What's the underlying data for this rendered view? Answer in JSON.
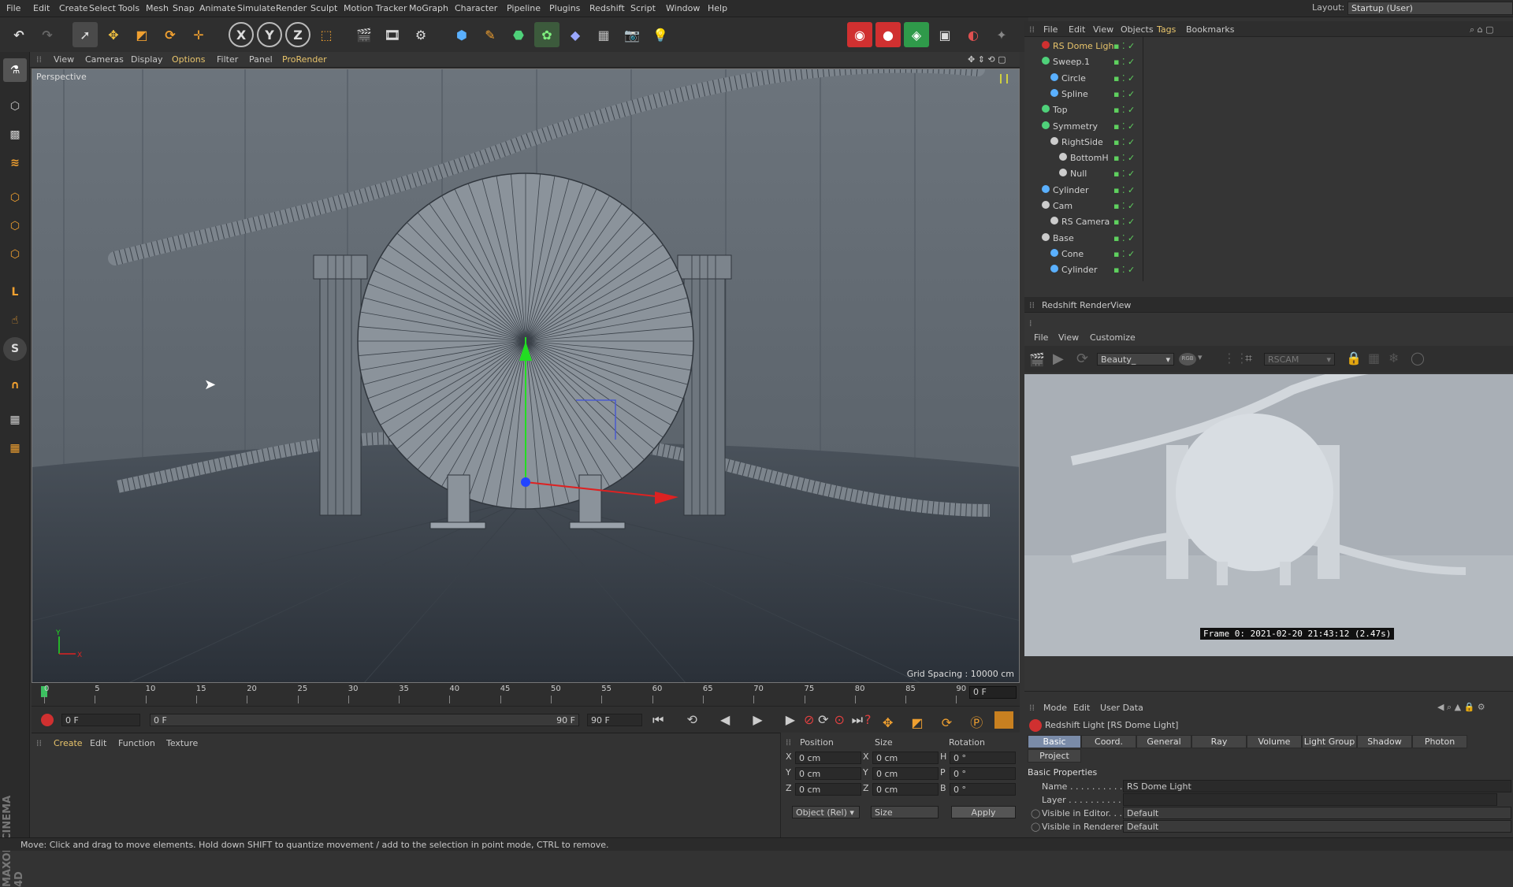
{
  "menu": [
    "File",
    "Edit",
    "Create",
    "Select",
    "Tools",
    "Mesh",
    "Snap",
    "Animate",
    "Simulate",
    "Render",
    "Sculpt",
    "Motion Tracker",
    "MoGraph",
    "Character",
    "Pipeline",
    "Plugins",
    "Redshift",
    "Script",
    "Window",
    "Help"
  ],
  "layout": {
    "label": "Layout:",
    "value": "Startup (User)"
  },
  "viewport": {
    "menu": [
      "View",
      "Cameras",
      "Display",
      "Options",
      "Filter",
      "Panel",
      "ProRender"
    ],
    "label": "Perspective",
    "grid_spacing": "Grid Spacing : 10000 cm",
    "axis_y": "Y",
    "axis_x": "X"
  },
  "timeline": {
    "ticks": [
      "0",
      "5",
      "10",
      "15",
      "20",
      "25",
      "30",
      "35",
      "40",
      "45",
      "50",
      "55",
      "60",
      "65",
      "70",
      "75",
      "80",
      "85",
      "90"
    ],
    "current": "0 F"
  },
  "transport": {
    "start": "0 F",
    "range_start": "0 F",
    "range_end": "90 F",
    "end": "90 F"
  },
  "material_menu": [
    "Create",
    "Edit",
    "Function",
    "Texture"
  ],
  "coords": {
    "headers": [
      "Position",
      "Size",
      "Rotation"
    ],
    "rows": [
      {
        "a": "X",
        "pos": "0 cm",
        "b": "X",
        "size": "0 cm",
        "c": "H",
        "rot": "0 °"
      },
      {
        "a": "Y",
        "pos": "0 cm",
        "b": "Y",
        "size": "0 cm",
        "c": "P",
        "rot": "0 °"
      },
      {
        "a": "Z",
        "pos": "0 cm",
        "b": "Z",
        "size": "0 cm",
        "c": "B",
        "rot": "0 °"
      }
    ],
    "mode": "Object (Rel)",
    "size_mode": "Size",
    "apply": "Apply"
  },
  "objects": {
    "menu": [
      "File",
      "Edit",
      "View",
      "Objects",
      "Tags",
      "Bookmarks"
    ],
    "items": [
      {
        "name": "RS Dome Ligh",
        "selected": true
      },
      {
        "name": "Sweep.1"
      },
      {
        "name": "Circle"
      },
      {
        "name": "Spline"
      },
      {
        "name": "Top"
      },
      {
        "name": "Symmetry"
      },
      {
        "name": "RightSide"
      },
      {
        "name": "BottomH"
      },
      {
        "name": "Null"
      },
      {
        "name": "Cylinder"
      },
      {
        "name": "Cam"
      },
      {
        "name": "RS Camera"
      },
      {
        "name": "Base"
      },
      {
        "name": "Cone"
      },
      {
        "name": "Cylinder"
      }
    ]
  },
  "renderview": {
    "title": "Redshift RenderView",
    "menu": [
      "File",
      "View",
      "Customize"
    ],
    "aov": "Beauty_",
    "rgb": "RGB",
    "camera": "RSCAM",
    "frame": "Frame  0:  2021-02-20  21:43:12  (2.47s)"
  },
  "attributes": {
    "menu": [
      "Mode",
      "Edit",
      "User Data"
    ],
    "title": "Redshift Light [RS Dome Light]",
    "tabs": [
      "Basic",
      "Coord.",
      "General",
      "Ray",
      "Volume",
      "Light Group",
      "Shadow",
      "Photon"
    ],
    "tab2": "Project",
    "section": "Basic Properties",
    "fields": [
      {
        "label": "Name . . . . . . . . . . . .",
        "value": "RS Dome Light"
      },
      {
        "label": "Layer . . . . . . . . . . . .",
        "value": ""
      },
      {
        "label": "Visible in Editor. . .",
        "value": "Default"
      },
      {
        "label": "Visible in Renderer",
        "value": "Default"
      }
    ]
  },
  "status": "Move: Click and drag to move elements. Hold down SHIFT to quantize movement / add to the selection in point mode, CTRL to remove.",
  "brand": "MAXON CINEMA 4D"
}
